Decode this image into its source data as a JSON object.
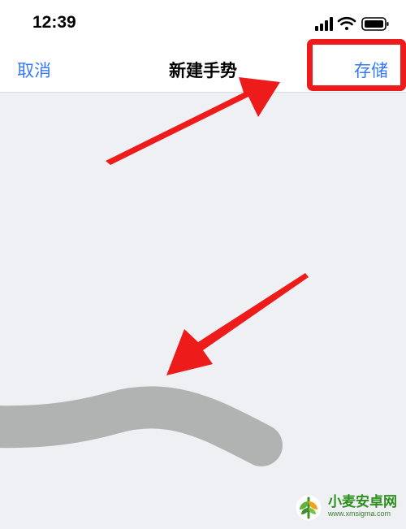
{
  "status_bar": {
    "time": "12:39",
    "icons": [
      "cellular-signal-icon",
      "wifi-icon",
      "battery-icon"
    ]
  },
  "nav": {
    "cancel_label": "取消",
    "title": "新建手势",
    "save_label": "存储"
  },
  "colors": {
    "accent": "#3478f6",
    "annotation_red": "#ee1b1b",
    "gesture_stroke": "#b1b3b3",
    "canvas_bg": "#eef0f4"
  },
  "watermark": {
    "name": "小麦安卓网",
    "url": "www.xmsigma.com"
  }
}
